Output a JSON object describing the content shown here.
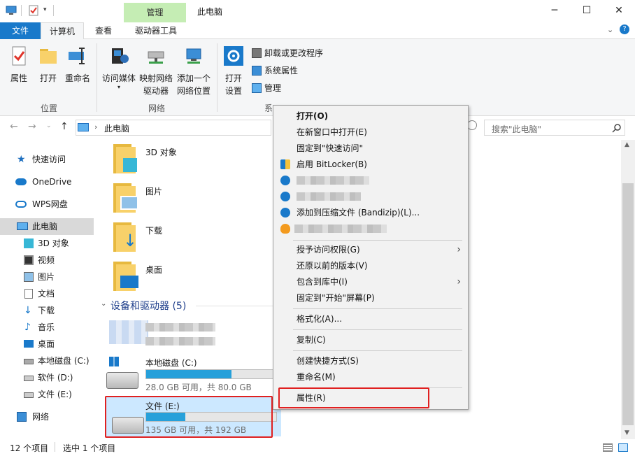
{
  "window": {
    "title": "此电脑",
    "context_tab": "管理",
    "controls": {
      "minimize": "─",
      "maximize": "☐",
      "close": "✕"
    }
  },
  "ribbon_tabs": [
    "文件",
    "计算机",
    "查看",
    "驱动器工具"
  ],
  "ribbon": {
    "location_group": {
      "label": "位置",
      "buttons": [
        "属性",
        "打开",
        "重命名"
      ]
    },
    "network_group": {
      "label": "网络",
      "media": "访问媒体",
      "map_drive_line1": "映射网络",
      "map_drive_line2": "驱动器",
      "add_location_line1": "添加一个",
      "add_location_line2": "网络位置"
    },
    "system_group": {
      "label": "系",
      "open_settings_line1": "打开",
      "open_settings_line2": "设置",
      "uninstall": "卸载或更改程序",
      "system_properties": "系统属性",
      "manage": "管理"
    }
  },
  "address": {
    "path": "此电脑",
    "search_placeholder": "搜索\"此电脑\""
  },
  "nav_pane": {
    "items": [
      {
        "label": "快速访问",
        "icon": "star-icon"
      },
      {
        "label": "OneDrive",
        "icon": "cloud-icon"
      },
      {
        "label": "WPS网盘",
        "icon": "cloud-icon"
      },
      {
        "label": "此电脑",
        "icon": "computer-icon",
        "selected": true
      },
      {
        "label": "3D 对象",
        "icon": "cube-icon"
      },
      {
        "label": "视频",
        "icon": "film-icon"
      },
      {
        "label": "图片",
        "icon": "picture-icon"
      },
      {
        "label": "文档",
        "icon": "document-icon"
      },
      {
        "label": "下载",
        "icon": "download-icon"
      },
      {
        "label": "音乐",
        "icon": "music-icon"
      },
      {
        "label": "桌面",
        "icon": "desktop-icon"
      },
      {
        "label": "本地磁盘 (C:)",
        "icon": "drive-icon"
      },
      {
        "label": "软件 (D:)",
        "icon": "drive-icon"
      },
      {
        "label": "文件 (E:)",
        "icon": "drive-icon"
      },
      {
        "label": "网络",
        "icon": "network-icon"
      }
    ]
  },
  "content": {
    "folders": [
      "3D 对象",
      "图片",
      "下载",
      "桌面"
    ],
    "devices_header": "设备和驱动器 (5)",
    "drives": [
      {
        "name": "本地磁盘 (C:)",
        "free": "28.0 GB 可用，共 80.0 GB",
        "used_fraction": 0.65
      },
      {
        "name": "文件 (E:)",
        "free": "135 GB 可用，共 192 GB",
        "used_fraction": 0.3
      }
    ]
  },
  "context_menu": {
    "items": [
      "打开(O)",
      "在新窗口中打开(E)",
      "固定到\"快速访问\"",
      "启用 BitLocker(B)",
      "添加到压缩文件 (Bandizip)(L)...",
      "授予访问权限(G)",
      "还原以前的版本(V)",
      "包含到库中(I)",
      "固定到\"开始\"屏幕(P)",
      "格式化(A)...",
      "复制(C)",
      "创建快捷方式(S)",
      "重命名(M)",
      "属性(R)"
    ]
  },
  "status": {
    "count": "12 个项目",
    "selected": "选中 1 个项目"
  },
  "colors": {
    "accent": "#1979ca",
    "manage_tab": "#c5edb4",
    "drive_bar": "#26a0da",
    "highlight_box": "#e02020",
    "selection": "#cce8ff"
  }
}
